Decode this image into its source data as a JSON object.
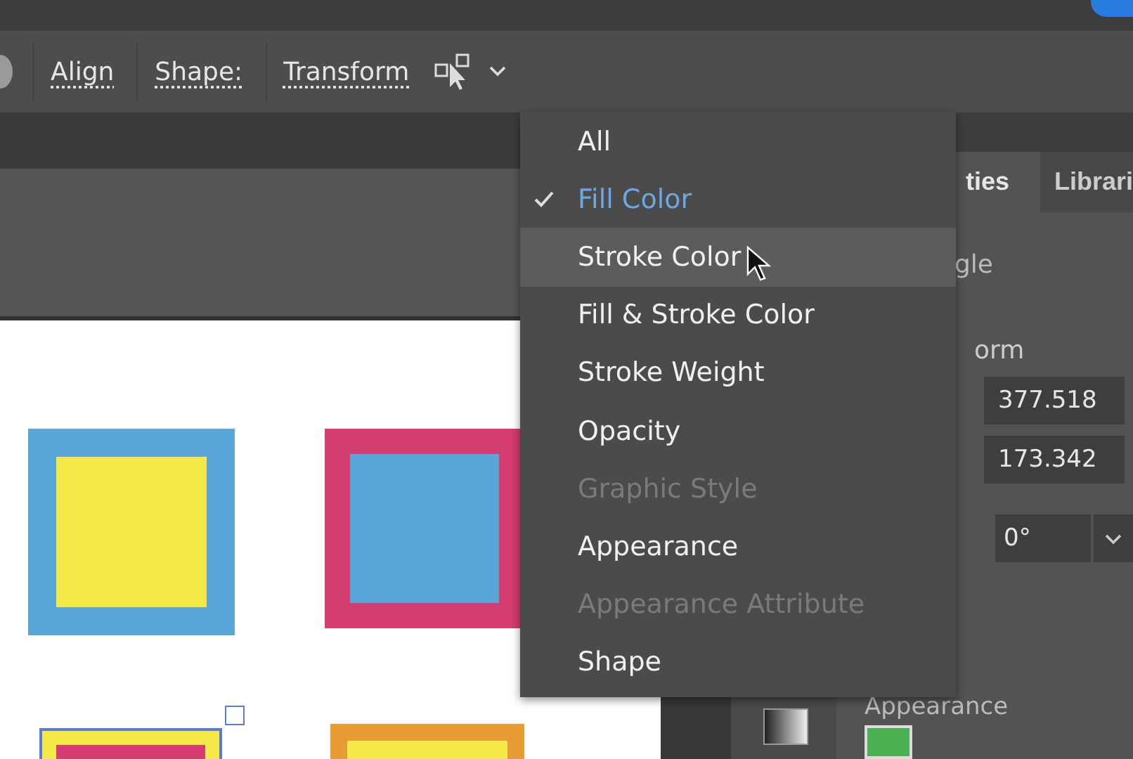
{
  "toolbar": {
    "items": [
      {
        "label": "Align"
      },
      {
        "label": "Shape:"
      },
      {
        "label": "Transform"
      }
    ]
  },
  "canvas": {
    "shapes": [
      {
        "stroke": {
          "color": "#5aa6db"
        },
        "fill": {
          "color": "#f5e94a"
        },
        "selected": false
      },
      {
        "stroke": {
          "color": "#d63d72"
        },
        "fill": {
          "color": "#5aa6db"
        },
        "selected": false
      },
      {
        "stroke": {
          "color": "#f5e94a"
        },
        "fill": {
          "color": "#d63d72"
        },
        "selected": true
      },
      {
        "stroke": {
          "color": "#e89a35"
        },
        "fill": {
          "color": "#f5e94a"
        },
        "selected": false
      }
    ]
  },
  "panel": {
    "tabs": [
      {
        "label": "ties",
        "selected": true
      },
      {
        "label": "Librari",
        "selected": false
      }
    ],
    "object_type": "gle",
    "section": "orm",
    "fields": [
      {
        "value": "377.518"
      },
      {
        "value": "173.342"
      }
    ],
    "rotation": {
      "value": "0°"
    },
    "appearance": "Appearance"
  },
  "menu": {
    "items": [
      {
        "label": "All",
        "checked": false,
        "disabled": false,
        "highlighted": false
      },
      {
        "label": "Fill Color",
        "checked": true,
        "disabled": false,
        "highlighted": false
      },
      {
        "label": "Stroke Color",
        "checked": false,
        "disabled": false,
        "highlighted": true
      },
      {
        "label": "Fill & Stroke Color",
        "checked": false,
        "disabled": false,
        "highlighted": false
      },
      {
        "label": "Stroke Weight",
        "checked": false,
        "disabled": false,
        "highlighted": false
      },
      {
        "label": "Opacity",
        "checked": false,
        "disabled": false,
        "highlighted": false
      },
      {
        "label": "Graphic Style",
        "checked": false,
        "disabled": true,
        "highlighted": false
      },
      {
        "label": "Appearance",
        "checked": false,
        "disabled": false,
        "highlighted": false
      },
      {
        "label": "Appearance Attribute",
        "checked": false,
        "disabled": true,
        "highlighted": false
      },
      {
        "label": "Shape",
        "checked": false,
        "disabled": false,
        "highlighted": false
      }
    ]
  }
}
